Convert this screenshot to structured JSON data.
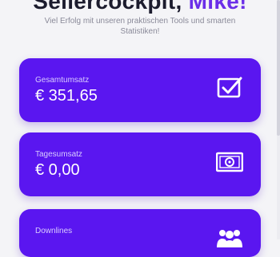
{
  "header": {
    "title": "Sellercockpit,",
    "title_accent": "Mike!",
    "subtitle": "Viel Erfolg mit unseren praktischen Tools und smarten Statistiken!"
  },
  "cards": [
    {
      "label": "Gesamtumsatz",
      "value": "€ 351,65",
      "icon": "checkbox-icon"
    },
    {
      "label": "Tagesumsatz",
      "value": "€ 0,00",
      "icon": "banknote-icon"
    },
    {
      "label": "Downlines",
      "value": "",
      "icon": "users-icon"
    }
  ],
  "colors": {
    "card_bg": "#5a16f0",
    "accent": "#6b2fe8",
    "page_bg": "#f4f4f7"
  }
}
